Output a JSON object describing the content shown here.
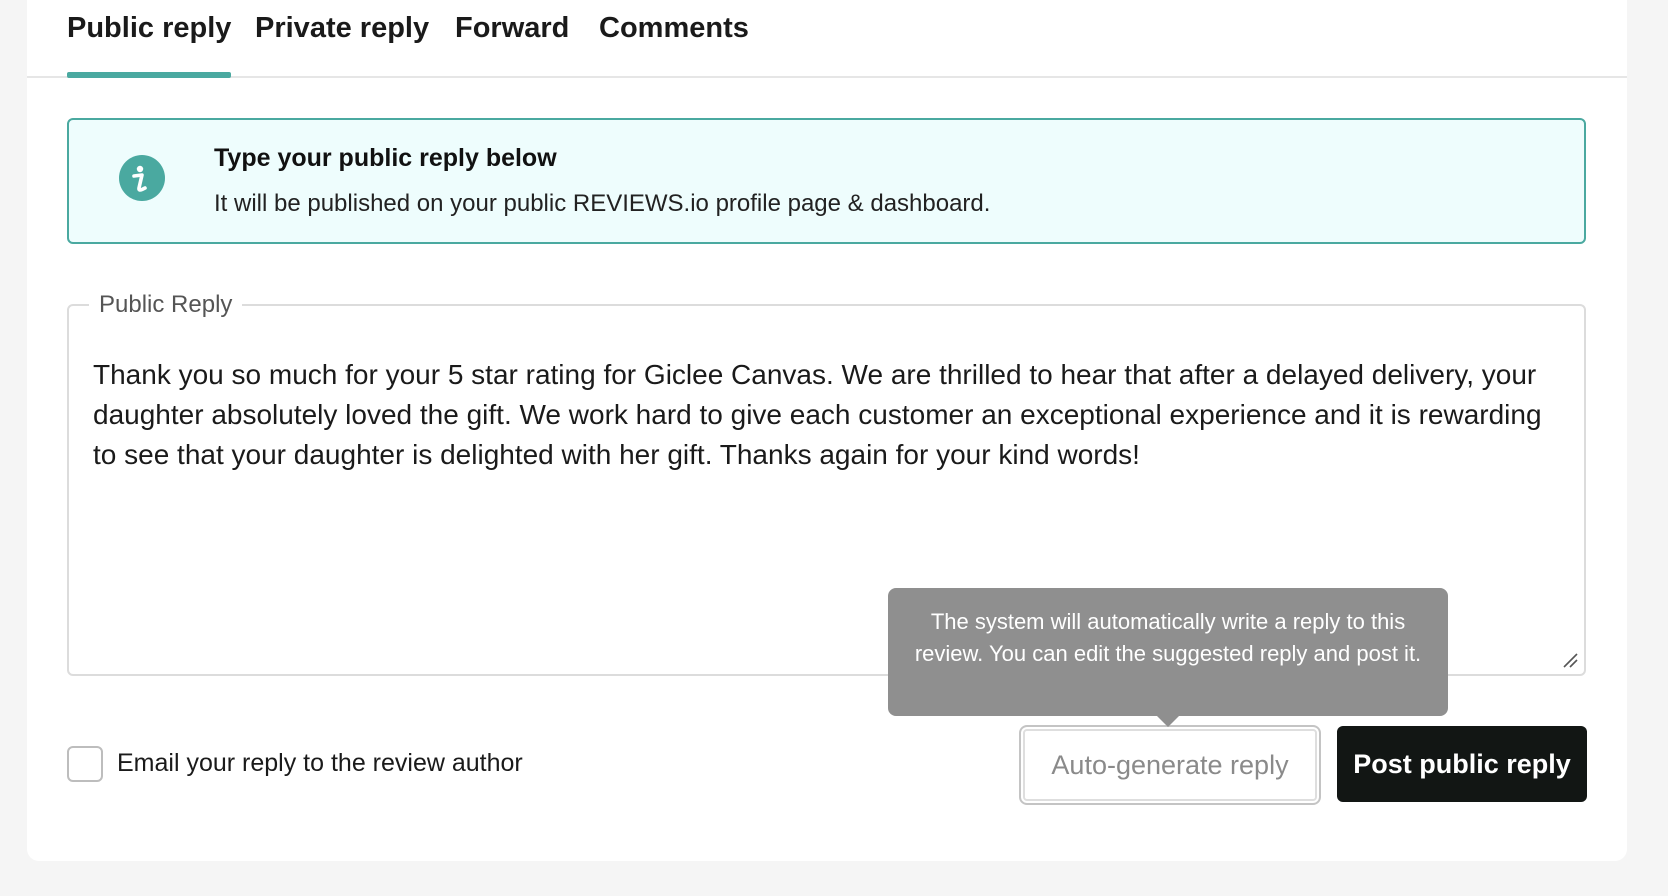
{
  "tabs": [
    {
      "label": "Public reply",
      "active": true
    },
    {
      "label": "Private reply",
      "active": false
    },
    {
      "label": "Forward",
      "active": false
    },
    {
      "label": "Comments",
      "active": false
    }
  ],
  "info": {
    "icon": "info-icon",
    "title": "Type your public reply below",
    "text": "It will be published on your public REVIEWS.io profile page & dashboard."
  },
  "reply": {
    "legend": "Public Reply",
    "value": "Thank you so much for your 5 star rating for Giclee Canvas. We are thrilled to hear that after a delayed delivery, your daughter absolutely loved the gift. We work hard to give each customer an exceptional experience and it is rewarding to see that your daughter is delighted with her gift. Thanks again for your kind words!"
  },
  "email_option": {
    "label": "Email your reply to the review author",
    "checked": false
  },
  "tooltip": {
    "text": "The system will automatically write a reply to this review. You can edit the suggested reply and post it."
  },
  "buttons": {
    "auto_generate": "Auto-generate reply",
    "post": "Post public reply"
  },
  "colors": {
    "accent": "#4aa9a0",
    "info_bg": "#eefdfd",
    "primary_button": "#121614",
    "tooltip_bg": "#8f8f8f"
  }
}
